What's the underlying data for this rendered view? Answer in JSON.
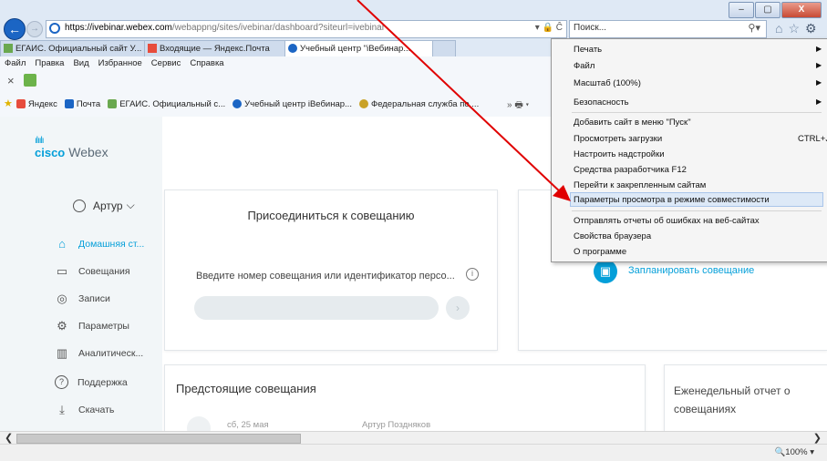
{
  "browser": {
    "window_controls": [
      "–",
      "▢",
      "X"
    ],
    "url_domain": "https://ivebinar.webex.com",
    "url_path": "/webappng/sites/ivebinar/dashboard?siteurl=ivebinar",
    "address_tools": "▾ 🔒 Ĉ",
    "search_placeholder": "Поиск...",
    "search_icon": "search-icon",
    "tabs": [
      {
        "label": "ЕГАИС. Официальный сайт У...",
        "icon": "egais-icon",
        "color": "#6aa84f"
      },
      {
        "label": "Входящие — Яндекс.Почта",
        "icon": "mail-icon",
        "color": "#e74c3c"
      },
      {
        "label": "Учебный центр \"iВебинар...",
        "icon": "webex-tab-icon",
        "color": "#1b65c4"
      }
    ],
    "menu": [
      "Файл",
      "Правка",
      "Вид",
      "Избранное",
      "Сервис",
      "Справка"
    ],
    "favorites": [
      {
        "label": "Яндекс",
        "color": "#e74c3c"
      },
      {
        "label": "Почта",
        "color": "#1b65c4"
      },
      {
        "label": "ЕГАИС. Официальный с...",
        "color": "#6aa84f"
      },
      {
        "label": "Учебный центр iВебинар...",
        "color": "#1b65c4"
      },
      {
        "label": "Федеральная служба по ...",
        "color": "#c9a227"
      }
    ],
    "favorites_more": "»  🖶 ▾",
    "zoom": "🔍100%  ▾"
  },
  "tools_menu": {
    "items": [
      {
        "label": "Печать",
        "submenu": true
      },
      {
        "label": "Файл",
        "submenu": true
      },
      {
        "label": "Масштаб (100%)",
        "submenu": true
      },
      {
        "label": "Безопасность",
        "submenu": true
      },
      {
        "label": "Добавить сайт в меню \"Пуск\""
      },
      {
        "label": "Просмотреть загрузки",
        "shortcut": "CTRL+J"
      },
      {
        "label": "Настроить надстройки"
      },
      {
        "label": "Средства разработчика F12"
      },
      {
        "label": "Перейти к закрепленным сайтам"
      },
      {
        "label": "Параметры просмотра в режиме совместимости",
        "highlighted": true
      },
      {
        "label": "Отправлять отчеты об ошибках на веб-сайтах"
      },
      {
        "label": "Свойства браузера"
      },
      {
        "label": "О программе"
      }
    ]
  },
  "webex": {
    "logo_bars": "ılıılı",
    "logo_cisco": "cisco",
    "logo_product": "Webex",
    "user_name": "Артур",
    "user_chevron": "⌵",
    "nav": [
      {
        "label": "Домашняя ст...",
        "icon": "home-icon",
        "glyph": "⌂",
        "active": true
      },
      {
        "label": "Совещания",
        "icon": "calendar-icon",
        "glyph": "▭"
      },
      {
        "label": "Записи",
        "icon": "record-icon",
        "glyph": "◎"
      },
      {
        "label": "Параметры",
        "icon": "settings-icon",
        "glyph": "⚙"
      },
      {
        "label": "Аналитическ...",
        "icon": "analytics-icon",
        "glyph": "▥"
      },
      {
        "label": "Поддержка",
        "icon": "help-icon",
        "glyph": "?"
      },
      {
        "label": "Скачать",
        "icon": "download-icon",
        "glyph": "⤓"
      }
    ],
    "join_title": "Присоединиться к совещанию",
    "join_label": "Введите номер совещания или идентификатор персо...",
    "info_glyph": "i",
    "go_glyph": "›",
    "schedule_label": "Запланировать совещание",
    "schedule_glyph": "▣",
    "upcoming_title": "Предстоящие совещания",
    "upcoming_date": "сб, 25 мая",
    "upcoming_host": "Артур Поздняков",
    "weekly_title": "Еженедельный отчет о совещаниях"
  },
  "colors": {
    "accent": "#049fd9",
    "annotation_arrow": "#e00000"
  }
}
